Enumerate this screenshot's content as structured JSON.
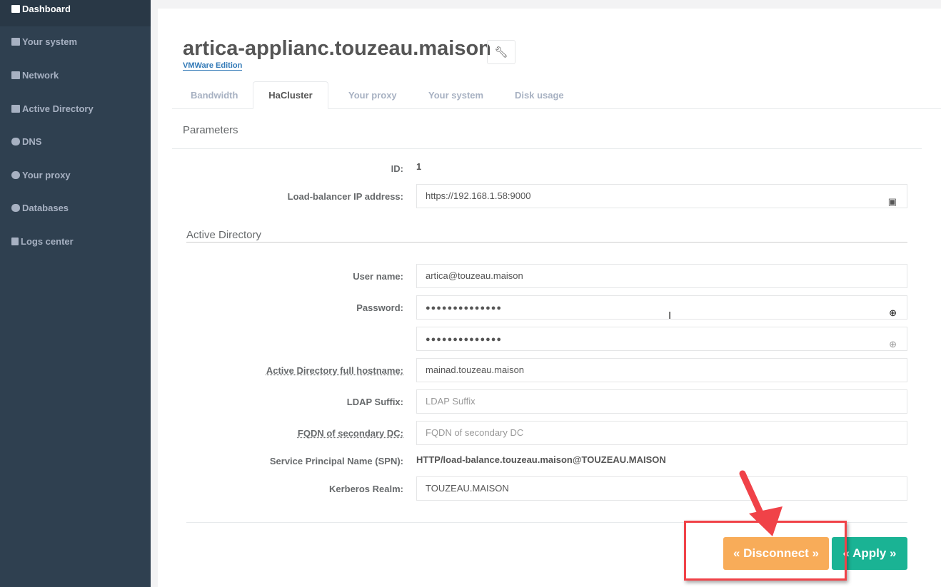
{
  "sidebar": {
    "items": [
      {
        "label": "Dashboard",
        "icon": "th-large-icon",
        "active": true
      },
      {
        "label": "Your system",
        "icon": "server-icon"
      },
      {
        "label": "Network",
        "icon": "sitemap-icon"
      },
      {
        "label": "Active Directory",
        "icon": "windows-icon"
      },
      {
        "label": "DNS",
        "icon": "database-icon"
      },
      {
        "label": "Your proxy",
        "icon": "globe-icon"
      },
      {
        "label": "Databases",
        "icon": "database-icon"
      },
      {
        "label": "Logs center",
        "icon": "file-icon"
      }
    ]
  },
  "header": {
    "title": "artica-applianc.touzeau.maison",
    "subtitle": "VMWare Edition"
  },
  "tabs": [
    "Bandwidth",
    "HaCluster",
    "Your proxy",
    "Your system",
    "Disk usage"
  ],
  "section": "Parameters",
  "form": {
    "id_label": "ID:",
    "id_value": "1",
    "lb_label": "Load-balancer IP address:",
    "lb_value": "https://192.168.1.58:9000",
    "ad_heading": "Active Directory",
    "user_label": "User name:",
    "user_value": "artica@touzeau.maison",
    "pass_label": "Password:",
    "pass_value": "●●●●●●●●●●●●●●",
    "pass_confirm": "●●●●●●●●●●●●●●",
    "host_label": "Active Directory full hostname:",
    "host_value": "mainad.touzeau.maison",
    "ldap_label": "LDAP Suffix:",
    "ldap_placeholder": "LDAP Suffix",
    "fqdn_label": "FQDN of secondary DC:",
    "fqdn_placeholder": "FQDN of secondary DC",
    "spn_label": "Service Principal Name (SPN):",
    "spn_value": "HTTP/load-balance.touzeau.maison@TOUZEAU.MAISON",
    "realm_label": "Kerberos Realm:",
    "realm_value": "TOUZEAU.MAISON"
  },
  "buttons": {
    "disconnect": "« Disconnect »",
    "apply": "« Apply »"
  },
  "colors": {
    "sidebar": "#2f4050",
    "disconnect": "#f8ac59",
    "apply": "#1ab394",
    "annotation": "#f04248"
  }
}
